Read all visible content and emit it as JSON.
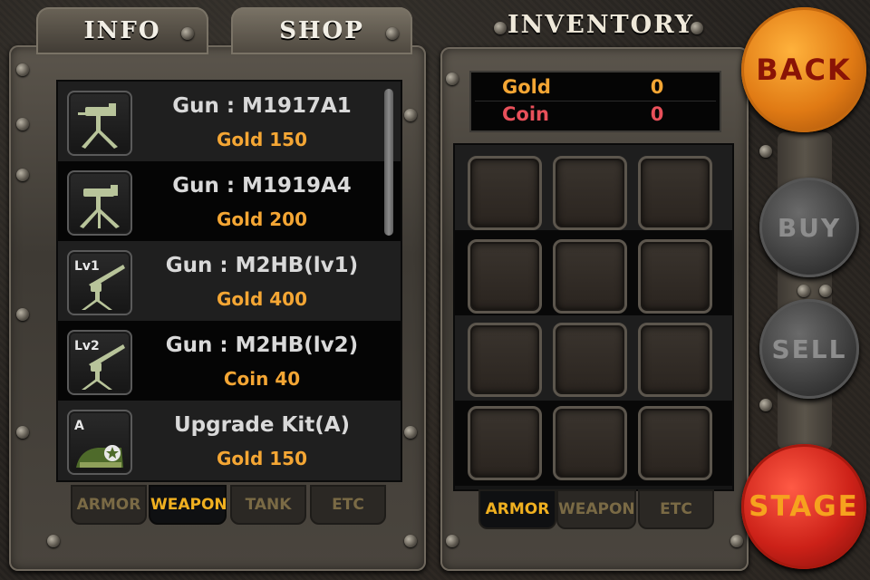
{
  "top_tabs": [
    "INFO",
    "SHOP"
  ],
  "inventory_title": "INVENTORY",
  "shop": {
    "items": [
      {
        "name": "Gun : M1917A1",
        "price": "Gold 150",
        "icon": "machine-gun-icon",
        "level": ""
      },
      {
        "name": "Gun : M1919A4",
        "price": "Gold 200",
        "icon": "machine-gun-icon",
        "level": ""
      },
      {
        "name": "Gun : M2HB(lv1)",
        "price": "Gold 400",
        "icon": "heavy-machine-gun-icon",
        "level": "Lv1"
      },
      {
        "name": "Gun : M2HB(lv2)",
        "price": "Coin 40",
        "icon": "heavy-machine-gun-icon",
        "level": "Lv2"
      },
      {
        "name": "Upgrade Kit(A)",
        "price": "Gold 150",
        "icon": "tank-upgrade-kit-icon",
        "level": "A"
      }
    ],
    "category_tabs": [
      "ARMOR",
      "WEAPON",
      "TANK",
      "ETC"
    ],
    "active_category": "WEAPON"
  },
  "inventory": {
    "currency": [
      {
        "label": "Gold",
        "value": "0",
        "color": "#f4a634"
      },
      {
        "label": "Coin",
        "value": "0",
        "color": "#e8505a"
      }
    ],
    "category_tabs": [
      "ARMOR",
      "WEAPON",
      "ETC"
    ],
    "active_category": "ARMOR"
  },
  "buttons": {
    "back": "BACK",
    "buy": "BUY",
    "sell": "SELL",
    "stage": "STAGE"
  }
}
